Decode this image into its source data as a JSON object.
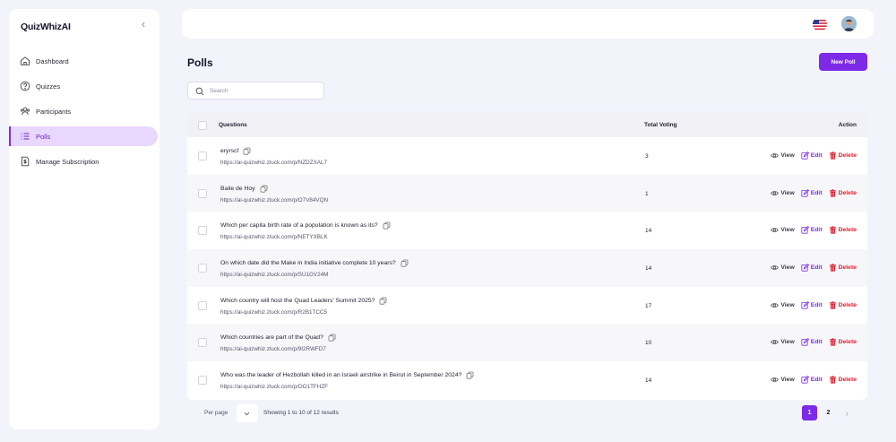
{
  "app": {
    "name": "QuizWhizAI"
  },
  "sidebar": {
    "items": [
      {
        "label": "Dashboard",
        "icon": "home-icon"
      },
      {
        "label": "Quizzes",
        "icon": "question-icon"
      },
      {
        "label": "Participants",
        "icon": "users-icon"
      },
      {
        "label": "Polls",
        "icon": "list-icon",
        "active": true
      },
      {
        "label": "Manage Subscription",
        "icon": "dollar-doc-icon"
      }
    ]
  },
  "page": {
    "title": "Polls",
    "new_button": "New Poll",
    "search_placeholder": "Search"
  },
  "table": {
    "headers": {
      "question": "Questions",
      "total": "Total Voting",
      "action": "Action"
    },
    "actions": {
      "view": "View",
      "edit": "Edit",
      "delete": "Delete"
    },
    "rows": [
      {
        "question": "eryrscf",
        "url": "https://ai-quizwhiz.zluck.com/p/NZDZXAL7",
        "votes": "3"
      },
      {
        "question": "Baile de Hoy",
        "url": "https://ai-quizwhiz.zluck.com/p/O7V84VQN",
        "votes": "1"
      },
      {
        "question": "Which per capita birth rate of a population is known as its?",
        "url": "https://ai-quizwhiz.zluck.com/p/NETYXBLK",
        "votes": "14"
      },
      {
        "question": "On which date did the Make in India initiative complete 10 years?",
        "url": "https://ai-quizwhiz.zluck.com/p/SU1GV24M",
        "votes": "14"
      },
      {
        "question": "Which country will host the Quad Leaders' Summit 2025?",
        "url": "https://ai-quizwhiz.zluck.com/p/R2B1TCC5",
        "votes": "17"
      },
      {
        "question": "Which countries are part of the Quad?",
        "url": "https://ai-quizwhiz.zluck.com/p/9I2RWFD7",
        "votes": "10"
      },
      {
        "question": "Who was the leader of Hezbollah killed in an Israeli airstrike in Beirut in September 2024?",
        "url": "https://ai-quizwhiz.zluck.com/p/OO1TFHZF",
        "votes": "14"
      }
    ]
  },
  "footer": {
    "per_page_label": "Per page",
    "showing": "Showing 1 to 10 of 12 results",
    "pages": [
      "1",
      "2"
    ],
    "next": "›"
  },
  "colors": {
    "accent": "#7c2ae8",
    "active_bg": "#e8d7ff",
    "delete": "#e11d2e",
    "background": "#f3f4fb"
  }
}
